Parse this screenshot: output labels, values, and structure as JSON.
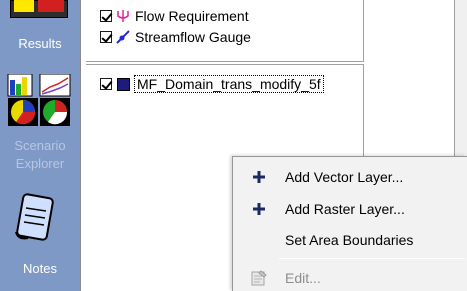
{
  "nav": {
    "items": [
      {
        "label": "Results",
        "icon": "results-icon"
      },
      {
        "label": "Scenario Explorer",
        "label_lines": [
          "Scenario",
          "Explorer"
        ],
        "icon": "scenario-explorer-icon"
      },
      {
        "label": "Notes",
        "icon": "notes-icon"
      }
    ]
  },
  "layers": {
    "top": [
      {
        "label": "Flow Requirement",
        "checked": true,
        "icon": "flow-requirement-icon",
        "icon_color": "#e2229c"
      },
      {
        "label": "Streamflow Gauge",
        "checked": true,
        "icon": "streamflow-gauge-icon",
        "icon_color": "#1f2ad6"
      }
    ],
    "bottom": [
      {
        "label": "MF_Domain_trans_modify_5f",
        "checked": true,
        "icon": "domain-layer-icon",
        "icon_color": "#1c1c7e",
        "selected": true
      }
    ]
  },
  "context_menu": {
    "items": [
      {
        "label": "Add Vector Layer...",
        "icon": "plus-icon",
        "enabled": true
      },
      {
        "label": "Add Raster Layer...",
        "icon": "plus-icon",
        "enabled": true
      },
      {
        "label": "Set Area Boundaries",
        "icon": "",
        "enabled": true
      },
      {
        "label": "Edit...",
        "icon": "properties-icon",
        "enabled": false
      }
    ]
  },
  "colors": {
    "nav_background": "#7f99c7",
    "menu_background": "#f2f2f2",
    "plus_icon": "#1b2a66"
  }
}
